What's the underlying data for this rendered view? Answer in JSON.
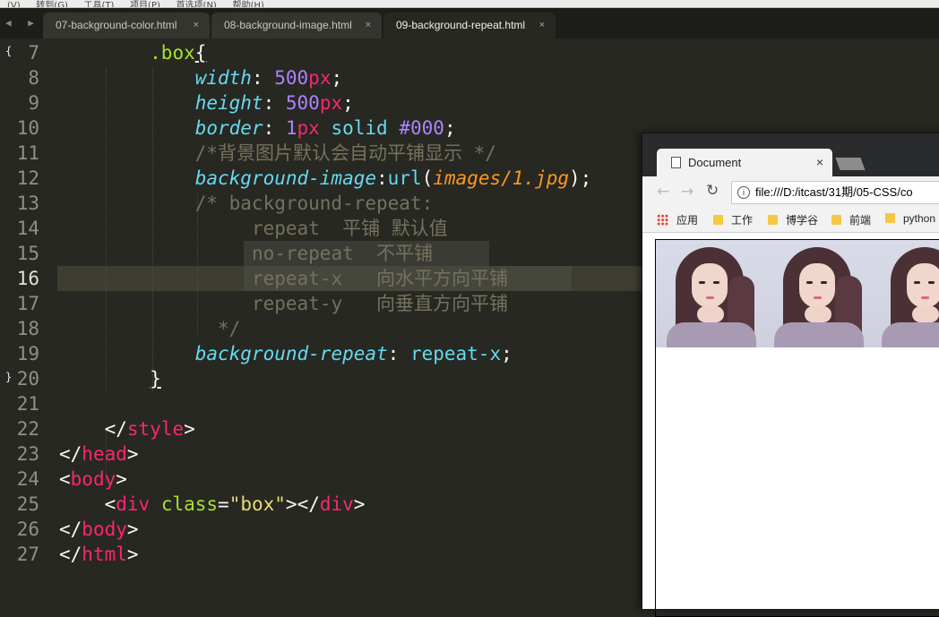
{
  "menu": {
    "items": [
      "(V)",
      "转到(G)",
      "工具(T)",
      "项目(P)",
      "首选项(N)",
      "帮助(H)"
    ]
  },
  "tabs": [
    {
      "label": "07-background-color.html",
      "close": "×"
    },
    {
      "label": "08-background-image.html",
      "close": "×"
    },
    {
      "label": "09-background-repeat.html",
      "close": "×"
    }
  ],
  "nav_arrows": "◀ ▶",
  "editor": {
    "line_numbers": [
      "7",
      "8",
      "9",
      "10",
      "11",
      "12",
      "13",
      "14",
      "15",
      "16",
      "17",
      "18",
      "19",
      "20",
      "21",
      "22",
      "23",
      "24",
      "25",
      "26",
      "27"
    ],
    "current_line": "16",
    "fold_markers": [
      "{",
      "}"
    ],
    "code": {
      "l7_sel": ".box",
      "l7_brace": "{",
      "l8_prop": "width",
      "l8_num": "500",
      "l8_unit": "px",
      "l9_prop": "height",
      "l9_num": "500",
      "l9_unit": "px",
      "l10_prop": "border",
      "l10_num": "1",
      "l10_unit": "px",
      "l10_rest": "solid",
      "l10_color": "#000",
      "l11": "/*背景图片默认会自动平铺显示 */",
      "l12_prop": "background-image",
      "l12_fn": "url",
      "l12_arg": "images/1.jpg",
      "l13": "/* background-repeat:",
      "l14": "repeat  平铺 默认值",
      "l15": "no-repeat  不平铺",
      "l16": "repeat-x   向水平方向平铺",
      "l17": "repeat-y   向垂直方向平铺",
      "l18": "*/",
      "l19_prop": "background-repeat",
      "l19_val": "repeat-x",
      "l20": "}",
      "l22_tag": "style",
      "l23_tag": "head",
      "l24_tag": "body",
      "l25_tag": "div",
      "l25_attr": "class",
      "l25_str": "\"box\"",
      "l26_tag": "body",
      "l27_tag": "html"
    }
  },
  "browser": {
    "tab_title": "Document",
    "tab_close": "×",
    "back": "←",
    "forward": "→",
    "reload": "↻",
    "info": "i",
    "url": "file:///D:/itcast/31期/05-CSS/co",
    "bookmarks": [
      {
        "label": "应用",
        "icon": "apps-icon"
      },
      {
        "label": "工作",
        "icon": "folder-icon"
      },
      {
        "label": "博学谷",
        "icon": "folder-icon"
      },
      {
        "label": "前端",
        "icon": "folder-icon"
      },
      {
        "label": "python",
        "icon": "folder-icon"
      }
    ]
  },
  "colors": {
    "editor_bg": "#272822",
    "selector": "#a6e22e",
    "property": "#66d9ef",
    "number": "#ae81ff",
    "keyword": "#f92672",
    "comment": "#75715e",
    "string": "#e6db74",
    "argument": "#fd971f"
  }
}
